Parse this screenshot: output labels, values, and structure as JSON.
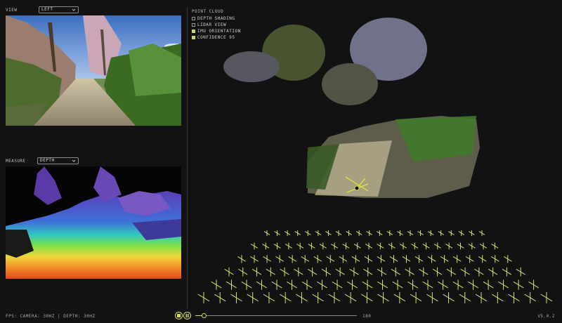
{
  "left": {
    "view_label": "VIEW",
    "view_select": "LEFT",
    "measure_label": "MEASURE",
    "measure_select": "DEPTH"
  },
  "point_cloud": {
    "title": "POINT CLOUD",
    "options": [
      {
        "label": "DEPTH SHADING",
        "checked": false
      },
      {
        "label": "LIDAR VIEW",
        "checked": false
      },
      {
        "label": "IMU ORIENTATION",
        "checked": true
      },
      {
        "label": "CONFIDENCE 95",
        "checked": true
      }
    ]
  },
  "footer": {
    "fps": "FPS: CAMERA: 30HZ | DEPTH: 30HZ",
    "frame_count": "180",
    "version": "V5.0.2",
    "progress": 0.05
  },
  "colors": {
    "accent": "#d4e04a",
    "grid": "#d6e26a"
  },
  "icons": [
    "chevron-down-icon",
    "play-icon",
    "pause-icon"
  ]
}
